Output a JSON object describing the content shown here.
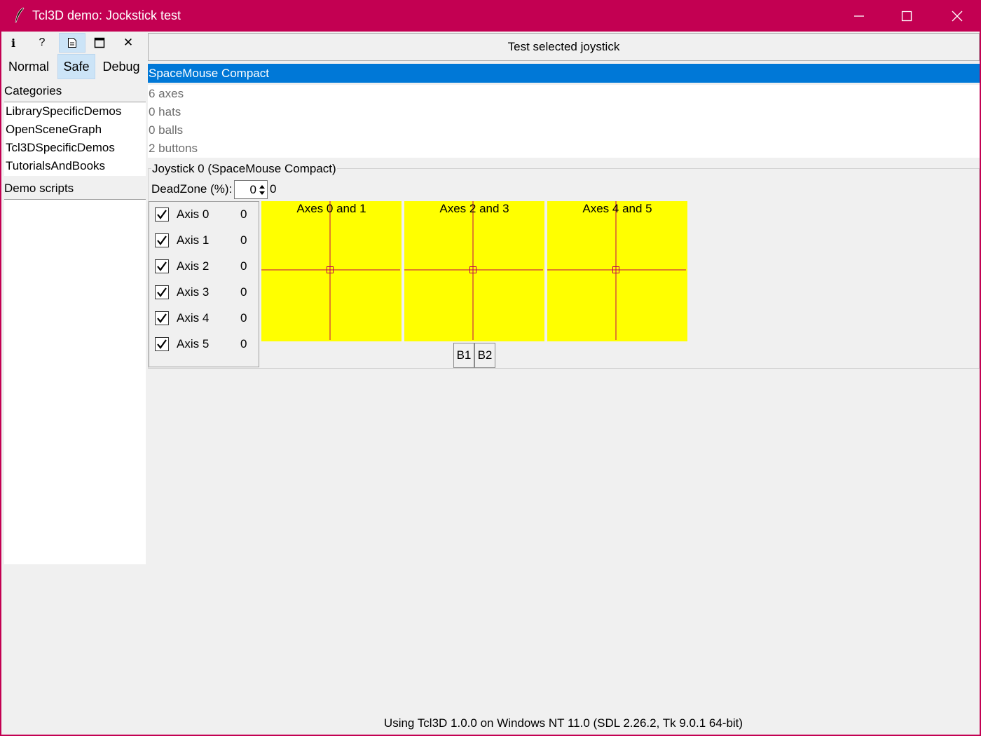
{
  "window": {
    "title": "Tcl3D demo: Jockstick test"
  },
  "toolbar": {
    "icons": [
      "info-icon",
      "help-icon",
      "document-icon",
      "maximize-window-icon",
      "close-icon"
    ],
    "info": "i",
    "help": "?",
    "close": "✕"
  },
  "modes": {
    "normal": "Normal",
    "safe": "Safe",
    "debug": "Debug",
    "selected": "Safe"
  },
  "categories": {
    "label": "Categories",
    "items": [
      "LibrarySpecificDemos",
      "OpenSceneGraph",
      "Tcl3DSpecificDemos",
      "TutorialsAndBooks"
    ]
  },
  "scripts": {
    "label": "Demo scripts",
    "items": []
  },
  "main": {
    "test_button": "Test selected joystick",
    "selected_device": "SpaceMouse Compact",
    "info": [
      "6 axes",
      "0 hats",
      "0 balls",
      "2 buttons"
    ],
    "group_title": "Joystick 0 (SpaceMouse Compact)",
    "deadzone_label": "DeadZone (%):",
    "deadzone_spin": "0",
    "deadzone_value": "0",
    "axes": [
      {
        "label": "Axis 0",
        "value": "0",
        "checked": true
      },
      {
        "label": "Axis 1",
        "value": "0",
        "checked": true
      },
      {
        "label": "Axis 2",
        "value": "0",
        "checked": true
      },
      {
        "label": "Axis 3",
        "value": "0",
        "checked": true
      },
      {
        "label": "Axis 4",
        "value": "0",
        "checked": true
      },
      {
        "label": "Axis 5",
        "value": "0",
        "checked": true
      }
    ],
    "pads": [
      {
        "title": "Axes 0 and 1",
        "x": 0,
        "y": 0
      },
      {
        "title": "Axes 2 and 3",
        "x": 0,
        "y": 0
      },
      {
        "title": "Axes 4 and 5",
        "x": 0,
        "y": 0
      }
    ],
    "buttons": [
      "B1",
      "B2"
    ]
  },
  "colors": {
    "titlebar": "#c30052",
    "selection": "#0078d7",
    "pad_background": "#ffff00",
    "crosshair": "#c00050"
  },
  "status": "Using Tcl3D 1.0.0 on Windows NT 11.0 (SDL 2.26.2, Tk 9.0.1 64-bit)"
}
